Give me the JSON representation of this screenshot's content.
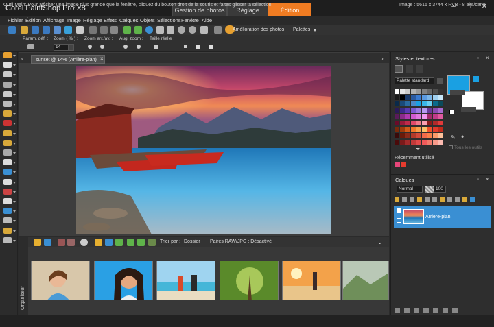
{
  "window": {
    "title": "Corel PaintShop Pro X8",
    "tabs": [
      {
        "label": "Gestion de photos",
        "active": false
      },
      {
        "label": "Réglage",
        "active": false
      },
      {
        "label": "Édition",
        "active": true
      }
    ],
    "controls": [
      "–",
      "□",
      "✕"
    ]
  },
  "menu": [
    "Fichier",
    "Édition",
    "Affichage",
    "Image",
    "Réglage",
    "Effets",
    "Calques",
    "Objets",
    "Sélections",
    "Fenêtre",
    "Aide"
  ],
  "toolbar": {
    "enhance_label": "Amélioration des photos",
    "palettes_label": "Palettes"
  },
  "tool_options": {
    "preset_label": "Param. déf. :",
    "zoom_label": "Zoom ( % ) :",
    "zoom_value": "14",
    "zoom_step_label": "Zoom arr./av. :",
    "aug_zoom_label": "Aug. zoom :",
    "actual_size_label": "Taille réelle :"
  },
  "document": {
    "tab_label": "sunset @  14% (Arrière-plan)",
    "close": "×"
  },
  "organizer": {
    "side_label": "Organiseur",
    "sort_label": "Trier par :",
    "folder_label": "Dossier",
    "raw_label": "Paires RAW/JPG : Désactivé"
  },
  "styles_panel": {
    "title": "Styles et textures",
    "palette_select": "Palette standard",
    "all_tools_label": "Tous les outils",
    "recent_label": "Récemment utilisé",
    "fg_color": "#1aa0e2",
    "bg_color": "#ffffff",
    "recent_colors": [
      "#e8467a",
      "#e63b2e"
    ]
  },
  "layers_panel": {
    "title": "Calques",
    "blend_mode": "Normal",
    "opacity": "100",
    "layer_name": "Arrière-plan"
  },
  "status": {
    "message": "Outil Main: Pour afficher une image plus grande que la fenêtre, cliquez du bouton droit de la souris et faites glisser la sélection.",
    "image_info": "Image : 5616 x 3744 x RVB - 8 bits/canal"
  }
}
